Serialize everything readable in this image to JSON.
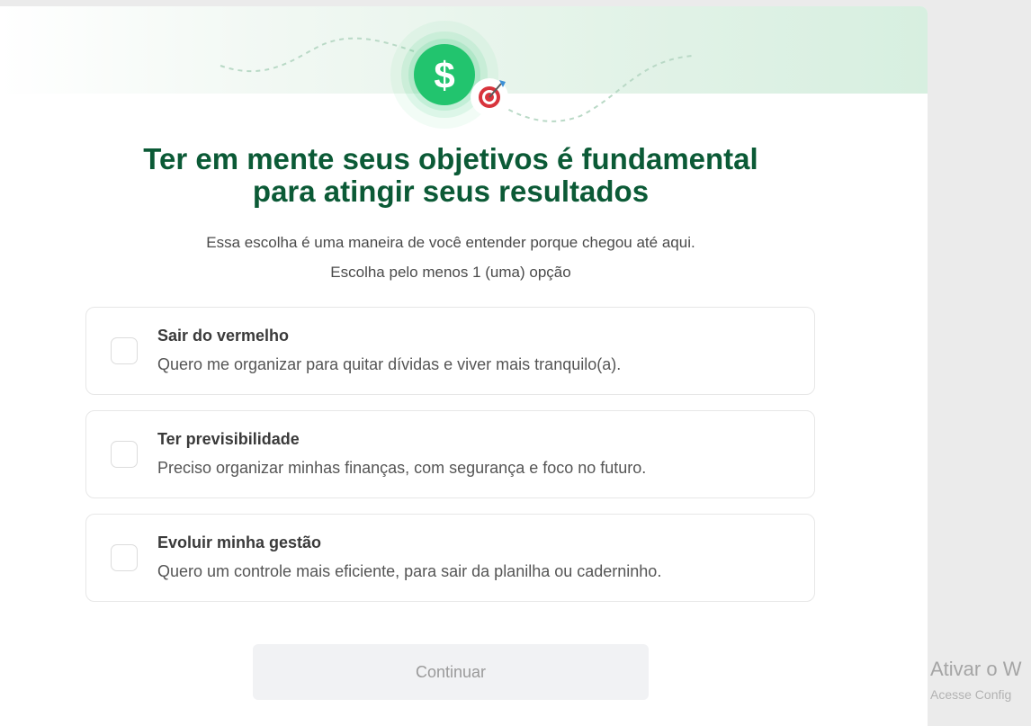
{
  "header": {
    "title_line1": "Ter em mente seus objetivos é fundamental",
    "title_line2": "para atingir seus resultados",
    "subtitle": "Essa escolha é uma maneira de você entender porque chegou até aqui.",
    "instruction": "Escolha pelo menos 1 (uma) opção",
    "icons": [
      "dollar-coin-icon",
      "target-dart-icon"
    ],
    "accent_color": "#22c46e",
    "title_color": "#0b5a36"
  },
  "options": [
    {
      "title": "Sair do vermelho",
      "description": "Quero me organizar para quitar dívidas e viver mais tranquilo(a).",
      "checked": false
    },
    {
      "title": "Ter previsibilidade",
      "description": "Preciso organizar minhas finanças, com segurança e foco no futuro.",
      "checked": false
    },
    {
      "title": "Evoluir minha gestão",
      "description": "Quero um controle mais eficiente, para sair da planilha ou caderninho.",
      "checked": false
    }
  ],
  "actions": {
    "continue_label": "Continuar",
    "continue_disabled": true
  },
  "watermark": {
    "line1": "Ativar o W",
    "line2": "Acesse Config"
  }
}
